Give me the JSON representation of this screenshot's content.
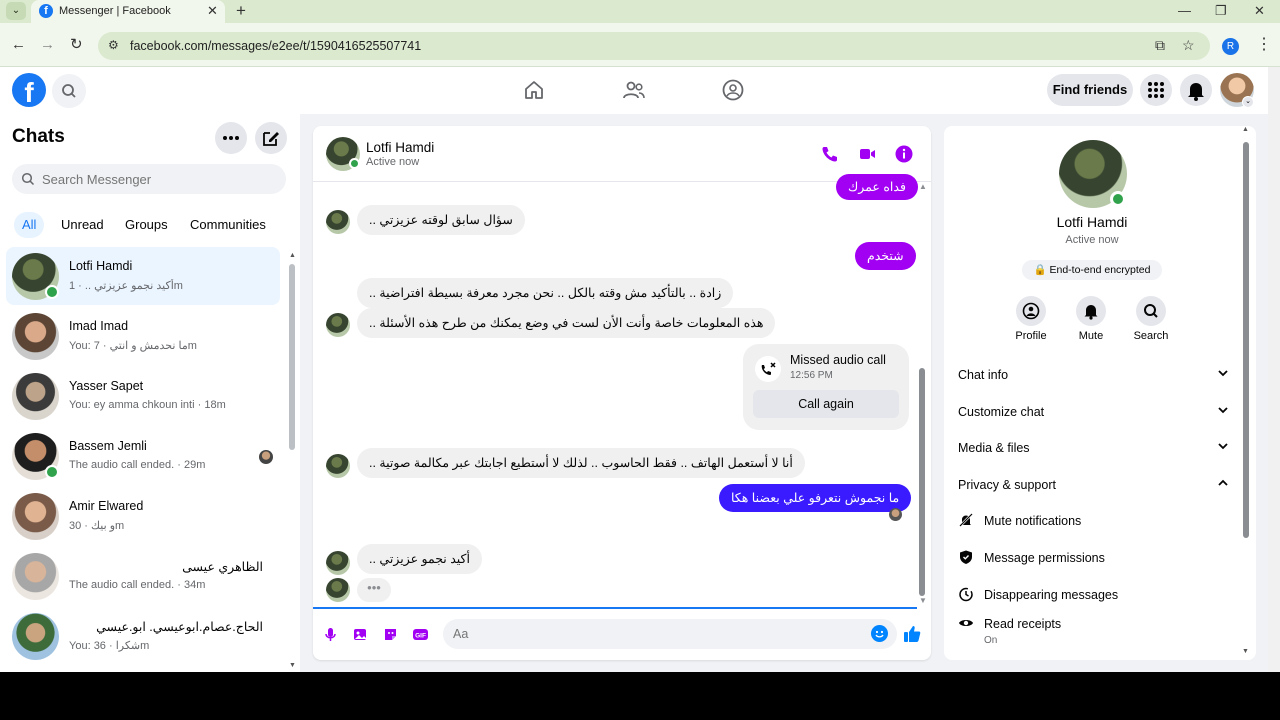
{
  "browser": {
    "tab_title": "Messenger | Facebook",
    "url": "facebook.com/messages/e2ee/t/1590416525507741",
    "profile_initial": "R"
  },
  "header": {
    "logo": "f",
    "find_friends": "Find friends"
  },
  "left": {
    "title": "Chats",
    "search_placeholder": "Search Messenger",
    "filters": [
      "All",
      "Unread",
      "Groups",
      "Communities"
    ],
    "chats": [
      {
        "name": "Lotfi Hamdi",
        "preview": "أكيد نجمو عزيزتي .. · 1m",
        "online": true
      },
      {
        "name": "Imad Imad",
        "preview": "You: ما نحدمش و انتي · 7m",
        "online": false
      },
      {
        "name": "Yasser Sapet",
        "preview": "You: ey amma chkoun inti · 18m",
        "online": false
      },
      {
        "name": "Bassem Jemli",
        "preview": "The audio call ended. · 29m",
        "online": true
      },
      {
        "name": "Amir Elwared",
        "preview": "و بيك · 30m",
        "online": false
      },
      {
        "name": "الظاهري عيسى",
        "preview": "The audio call ended. · 34m",
        "online": false
      },
      {
        "name": "الحاج.عصام.ابوعيسي. ابو.عيسي",
        "preview": "You: شكرا · 36m",
        "online": false
      }
    ]
  },
  "conversation": {
    "name": "Lotfi Hamdi",
    "status": "Active now",
    "messages": {
      "m1": "فداه عمرك",
      "m2": "سؤال سابق لوقته عزيزتي ..",
      "m3": "شتخدم",
      "m4": "زادة .. بالتأكيد مش وقته بالكل .. نحن مجرد معرفة بسيطة افتراضية ..",
      "m5": "هذه المعلومات خاصة وأنت الأن لست في وضع يمكنك من طرح هذه الأسئلة ..",
      "m6": "أنا لا أستعمل الهاتف .. فقط الحاسوب .. لذلك لا أستطيع اجابتك عبر مكالمة صوتية ..",
      "m7": "ما نجموش نتعرفو علي بعضنا هكا",
      "m8": "أكيد نجمو عزيزتي .."
    },
    "call": {
      "title": "Missed audio call",
      "time": "12:56 PM",
      "button": "Call again"
    },
    "typing": "•••",
    "composer_placeholder": "Aa"
  },
  "right": {
    "name": "Lotfi Hamdi",
    "status": "Active now",
    "encrypted": "🔒 End-to-end encrypted",
    "actions": {
      "profile": "Profile",
      "mute": "Mute",
      "search": "Search"
    },
    "sections": {
      "chat_info": "Chat info",
      "customize": "Customize chat",
      "media": "Media & files",
      "privacy": "Privacy & support"
    },
    "privacy_items": {
      "mute": "Mute notifications",
      "permissions": "Message permissions",
      "disappearing": "Disappearing messages",
      "receipts": "Read receipts",
      "receipts_state": "On"
    }
  },
  "colors": {
    "accent_purple": "#a100f2",
    "accent_blue": "#3a1aff",
    "fb_blue": "#1877f2",
    "online_green": "#31a24c"
  }
}
